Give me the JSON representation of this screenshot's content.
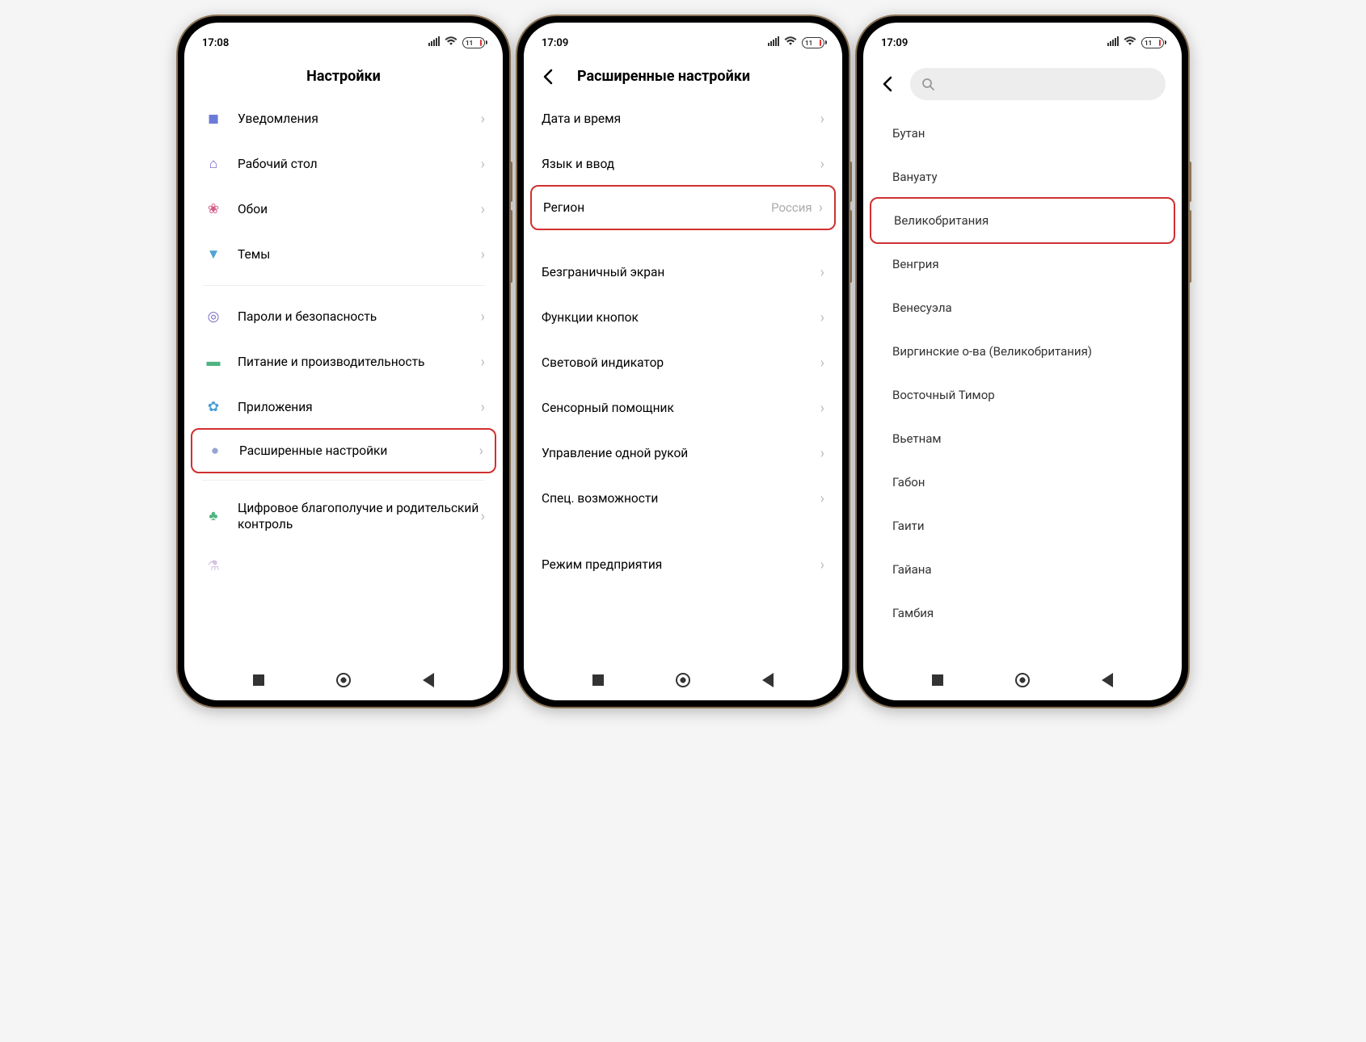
{
  "status": {
    "time1": "17:08",
    "time2": "17:09",
    "time3": "17:09",
    "battery": "11"
  },
  "screen1": {
    "title": "Настройки",
    "items": [
      {
        "label": "Уведомления"
      },
      {
        "label": "Рабочий стол"
      },
      {
        "label": "Обои"
      },
      {
        "label": "Темы"
      }
    ],
    "items2": [
      {
        "label": "Пароли и безопасность"
      },
      {
        "label": "Питание и производительность"
      },
      {
        "label": "Приложения"
      },
      {
        "label": "Расширенные настройки"
      }
    ],
    "items3": [
      {
        "label": "Цифровое благополучие и родительский контроль"
      }
    ]
  },
  "screen2": {
    "title": "Расширенные настройки",
    "items": [
      {
        "label": "Дата и время"
      },
      {
        "label": "Язык и ввод"
      },
      {
        "label": "Регион",
        "value": "Россия"
      }
    ],
    "items2": [
      {
        "label": "Безграничный экран"
      },
      {
        "label": "Функции кнопок"
      },
      {
        "label": "Световой индикатор"
      },
      {
        "label": "Сенсорный помощник"
      },
      {
        "label": "Управление одной рукой"
      },
      {
        "label": "Спец. возможности"
      }
    ],
    "items3": [
      {
        "label": "Режим предприятия"
      }
    ]
  },
  "screen3": {
    "countries": [
      "Бутан",
      "Вануату",
      "Великобритания",
      "Венгрия",
      "Венесуэла",
      "Виргинские о-ва (Великобритания)",
      "Восточный Тимор",
      "Вьетнам",
      "Габон",
      "Гаити",
      "Гайана",
      "Гамбия"
    ]
  },
  "highlighted_country_index": 2,
  "highlighted_setting2_index": 2,
  "highlighted_setting1_index": 3
}
